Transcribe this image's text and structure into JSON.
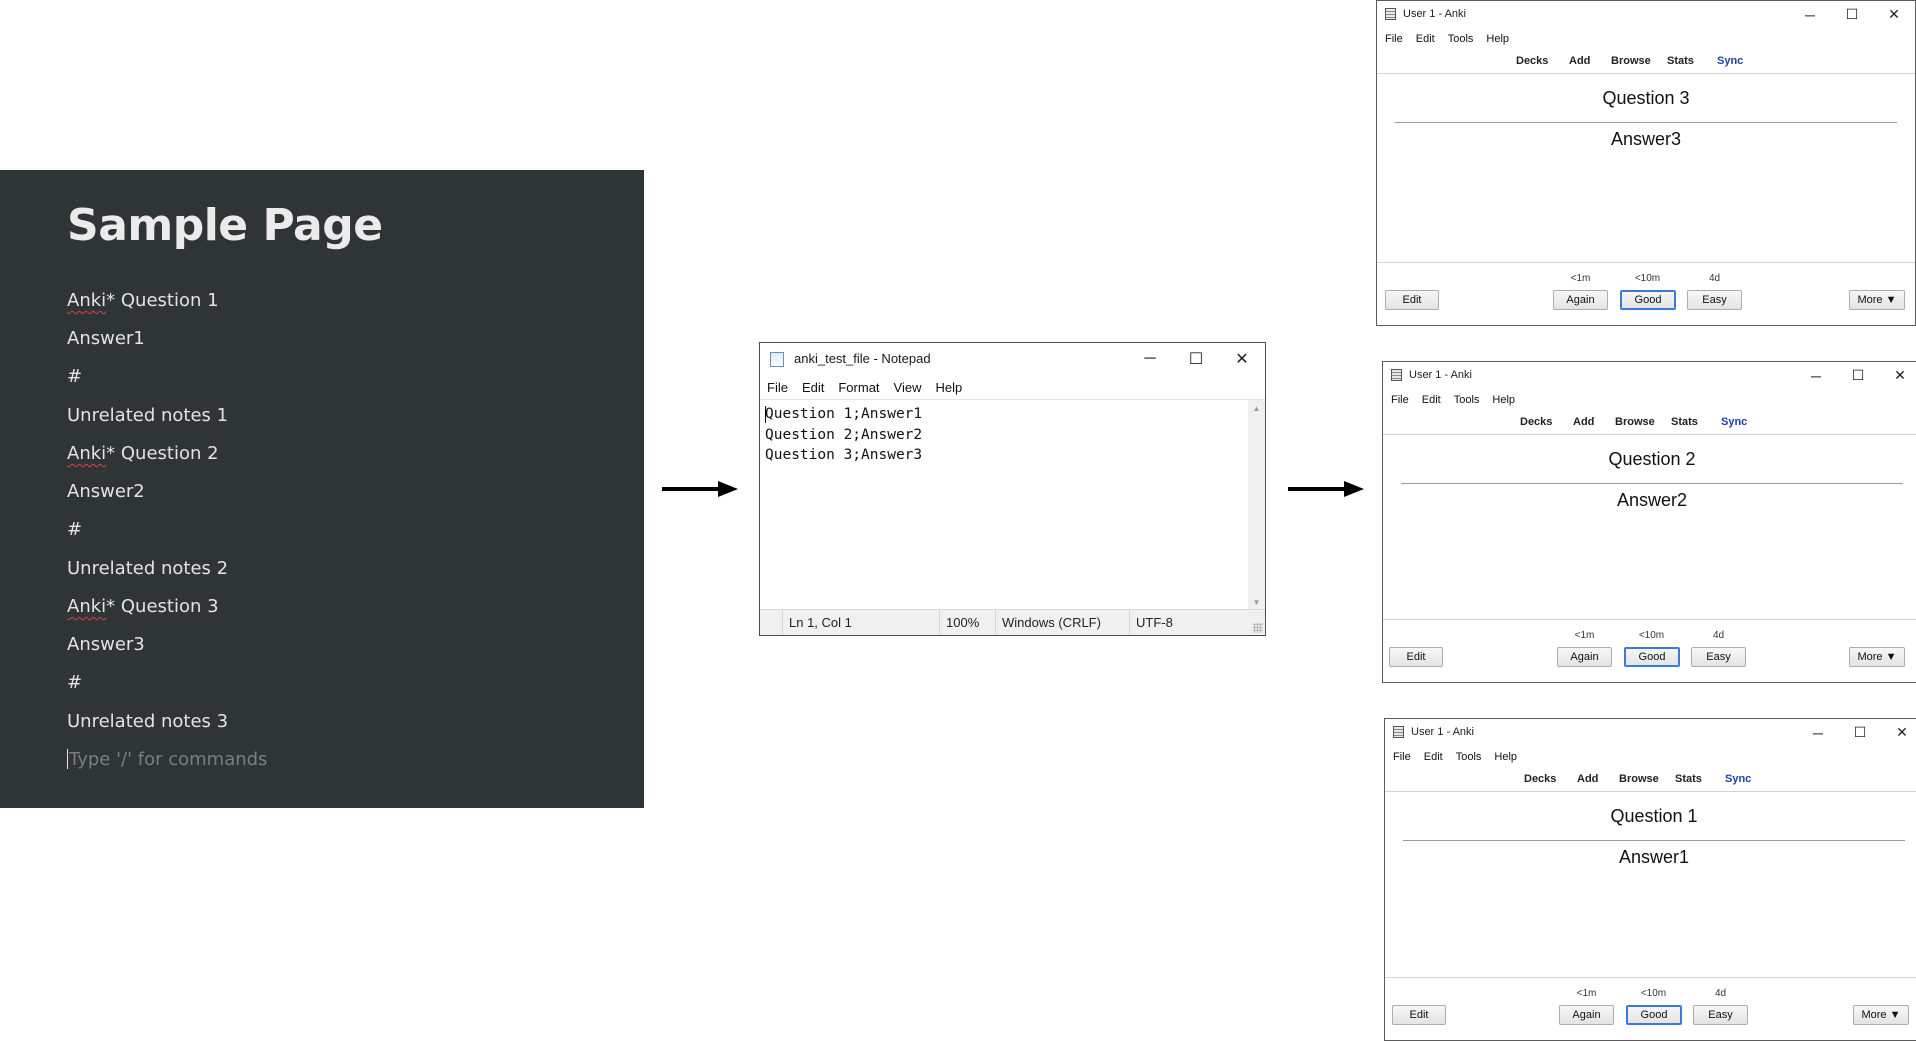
{
  "notion": {
    "title": "Sample Page",
    "blocks": [
      {
        "prefix": "Anki",
        "rest": "* Question 1"
      },
      {
        "text": "Answer1"
      },
      {
        "text": "#"
      },
      {
        "text": "Unrelated notes 1"
      },
      {
        "prefix": "Anki",
        "rest": "* Question 2"
      },
      {
        "text": "Answer2"
      },
      {
        "text": "#"
      },
      {
        "text": "Unrelated notes 2"
      },
      {
        "prefix": "Anki",
        "rest": "* Question 3"
      },
      {
        "text": "Answer3"
      },
      {
        "text": "#"
      },
      {
        "text": "Unrelated notes 3"
      }
    ],
    "placeholder": "Type '/' for commands"
  },
  "notepad": {
    "title": "anki_test_file - Notepad",
    "menu": [
      "File",
      "Edit",
      "Format",
      "View",
      "Help"
    ],
    "lines": [
      "Question 1;Answer1",
      "Question 2;Answer2",
      "Question 3;Answer3"
    ],
    "status": {
      "position": "Ln 1, Col 1",
      "zoom": "100%",
      "line_ending": "Windows (CRLF)",
      "encoding": "UTF-8"
    }
  },
  "anki_common": {
    "title": "User 1 - Anki",
    "menu": [
      "File",
      "Edit",
      "Tools",
      "Help"
    ],
    "toolbar": [
      "Decks",
      "Add",
      "Browse",
      "Stats",
      "Sync"
    ],
    "due": [
      "<1m",
      "<10m",
      "4d"
    ],
    "buttons": {
      "edit": "Edit",
      "again": "Again",
      "good": "Good",
      "easy": "Easy",
      "more": "More ▼"
    }
  },
  "anki_windows": [
    {
      "question": "Question 3",
      "answer": "Answer3"
    },
    {
      "question": "Question 2",
      "answer": "Answer2"
    },
    {
      "question": "Question 1",
      "answer": "Answer1"
    }
  ],
  "colors": {
    "notion_bg": "#2f3437",
    "sync_link": "#1a3fa8",
    "good_focus": "#3a7bd5"
  }
}
